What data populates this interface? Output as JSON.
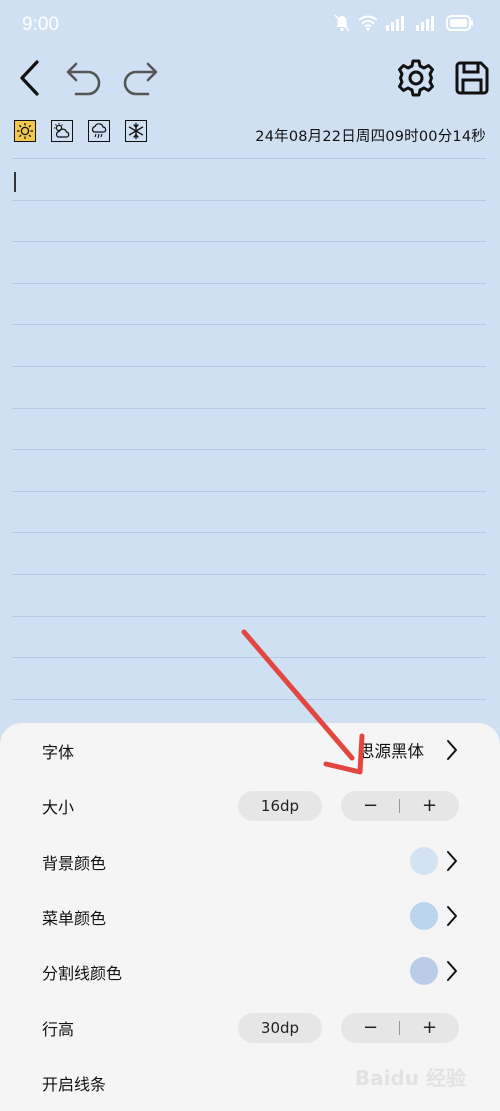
{
  "status_bar": {
    "time": "9:00",
    "icons": [
      "mute-icon",
      "wifi-icon",
      "signal-icon",
      "signal-icon",
      "battery-icon"
    ]
  },
  "toolbar": {
    "icons": [
      "back-icon",
      "undo-icon",
      "redo-icon",
      "settings-icon",
      "save-icon"
    ]
  },
  "weather": {
    "icons": [
      "sunny-icon",
      "cloudy-icon",
      "rainy-icon",
      "snow-icon"
    ],
    "selected": "sunny-icon",
    "selected_color": "#f2c94c"
  },
  "editor": {
    "datetime": "24年08月22日周四09时00分14秒",
    "background_color": "#cfe0f3",
    "line_color": "#b5cbe3"
  },
  "settings": {
    "font": {
      "label": "字体",
      "value": "思源黑体"
    },
    "size": {
      "label": "大小",
      "value": "16dp",
      "minus": "−",
      "plus": "+"
    },
    "background_color": {
      "label": "背景颜色",
      "color": "#d3e3f2"
    },
    "menu_color": {
      "label": "菜单颜色",
      "color": "#bcd5ee"
    },
    "divider_color": {
      "label": "分割线颜色",
      "color": "#b9cde6"
    },
    "line_height": {
      "label": "行高",
      "value": "30dp",
      "minus": "−",
      "plus": "+"
    },
    "enable_lines": {
      "label": "开启线条"
    }
  },
  "annotation": {
    "arrow_color": "#e2463f"
  },
  "watermark": {
    "text": "Baidu 经验"
  }
}
